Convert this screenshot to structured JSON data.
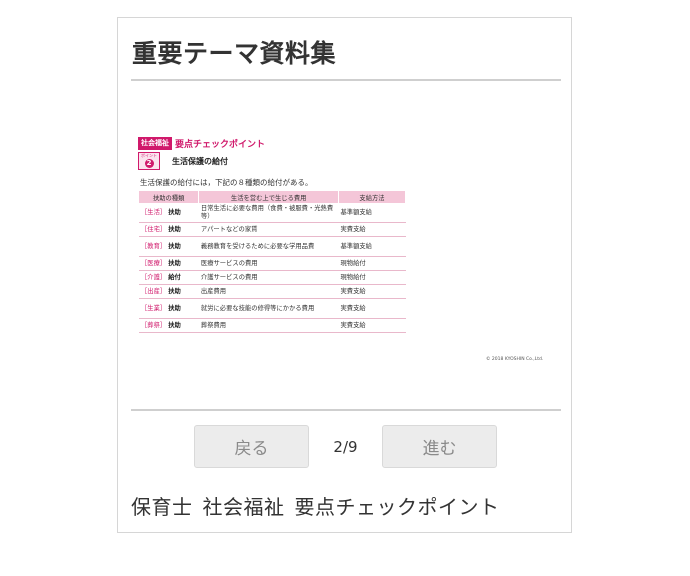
{
  "page_title": "重要テーマ資料集",
  "document": {
    "badge": "社会福祉",
    "header_title": "要点チェックポイント",
    "point_label": "ポイント",
    "point_number": "2",
    "subtitle": "生活保護の給付",
    "intro": "生活保護の給付には，下記の８種類の給付がある。",
    "table": {
      "headers": [
        "扶助の種類",
        "生活を営む上で生じる費用",
        "支給方法"
      ],
      "rows": [
        {
          "bracket": "［生活］",
          "kind": "扶助",
          "cost": "日常生活に必要な費用（食費・被服費・光熱費等）",
          "method": "基準額支給",
          "tall": true
        },
        {
          "bracket": "［住宅］",
          "kind": "扶助",
          "cost": "アパートなどの家賃",
          "method": "実費支給",
          "tall": false
        },
        {
          "bracket": "［教育］",
          "kind": "扶助",
          "cost": "義務教育を受けるために必要な学用品費",
          "method": "基準額支給",
          "tall": true
        },
        {
          "bracket": "［医療］",
          "kind": "扶助",
          "cost": "医療サービスの費用",
          "method": "現物給付",
          "tall": false
        },
        {
          "bracket": "［介護］",
          "kind": "給付",
          "cost": "介護サービスの費用",
          "method": "現物給付",
          "tall": false
        },
        {
          "bracket": "［出産］",
          "kind": "扶助",
          "cost": "出産費用",
          "method": "実費支給",
          "tall": false
        },
        {
          "bracket": "［生業］",
          "kind": "扶助",
          "cost": "就労に必要な技能の修得等にかかる費用",
          "method": "実費支給",
          "tall": true
        },
        {
          "bracket": "［葬祭］",
          "kind": "扶助",
          "cost": "葬祭費用",
          "method": "実費支給",
          "tall": false
        }
      ]
    },
    "copyright": "© 2018 KYOSHIN Co.,Ltd."
  },
  "nav": {
    "prev_label": "戻る",
    "next_label": "進む",
    "page_indicator": "2/9"
  },
  "tags": [
    "保育士",
    "社会福祉",
    "要点チェックポイント"
  ],
  "colors": {
    "accent": "#d0196b",
    "table_header": "#f4c6d8",
    "button_bg": "#ececec"
  }
}
